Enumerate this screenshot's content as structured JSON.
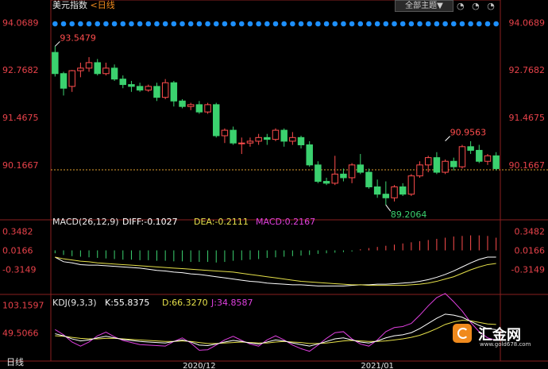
{
  "header": {
    "symbol_name": "美元指数",
    "period_tag": "<日线",
    "theme_button": "全部主题",
    "theme_arrow": "▼",
    "tool_icons": [
      "◔",
      "◔",
      "◔"
    ],
    "period_button": "日线"
  },
  "logo": {
    "name": "汇金网",
    "url": "www.gold678.com"
  },
  "colors": {
    "up": "#ff4d4d",
    "down": "#3bd16f",
    "axis_text": "#e8424a",
    "grid_text": "#f8e19a",
    "panel_text": "#e6e6e6",
    "yellow": "#e5e04a",
    "magenta": "#e040e0",
    "white": "#ffffff",
    "dots": "#1e90ff"
  },
  "chart_data": [
    {
      "panel": "price",
      "type": "candlestick",
      "y_ticks": [
        "94.0689",
        "92.7682",
        "91.4675",
        "90.1667"
      ],
      "y_tick_values": [
        94.0689,
        92.7682,
        91.4675,
        90.1667
      ],
      "ylim": [
        88.95,
        94.25
      ],
      "last_price_line": 90.1667,
      "annotations": [
        {
          "label": "93.5479",
          "value": 93.5479,
          "index": 0,
          "color": "#ff4d4d"
        },
        {
          "label": "90.9563",
          "value": 90.9563,
          "index": 46,
          "color": "#ff4d4d"
        },
        {
          "label": "89.2064",
          "value": 89.2064,
          "index": 39,
          "color": "#3bd16f"
        }
      ],
      "ohlc": [
        [
          93.38,
          93.55,
          92.72,
          92.8
        ],
        [
          92.8,
          92.85,
          92.2,
          92.4
        ],
        [
          92.45,
          92.9,
          92.3,
          92.88
        ],
        [
          92.88,
          93.1,
          92.7,
          92.95
        ],
        [
          92.95,
          93.25,
          92.85,
          93.1
        ],
        [
          93.1,
          93.2,
          92.75,
          92.8
        ],
        [
          92.8,
          93.1,
          92.75,
          92.95
        ],
        [
          92.95,
          93.05,
          92.6,
          92.65
        ],
        [
          92.65,
          92.75,
          92.4,
          92.5
        ],
        [
          92.5,
          92.6,
          92.3,
          92.45
        ],
        [
          92.45,
          92.55,
          92.3,
          92.35
        ],
        [
          92.35,
          92.5,
          92.3,
          92.45
        ],
        [
          92.45,
          92.55,
          92.05,
          92.15
        ],
        [
          92.15,
          92.65,
          92.1,
          92.55
        ],
        [
          92.55,
          92.6,
          91.9,
          92.05
        ],
        [
          92.05,
          92.1,
          91.85,
          91.9
        ],
        [
          91.9,
          92.0,
          91.8,
          91.95
        ],
        [
          91.95,
          92.05,
          91.7,
          91.75
        ],
        [
          91.75,
          92.0,
          91.7,
          91.95
        ],
        [
          91.95,
          92.0,
          91.05,
          91.1
        ],
        [
          91.1,
          91.3,
          90.9,
          91.25
        ],
        [
          91.25,
          91.35,
          90.85,
          90.9
        ],
        [
          90.9,
          91.05,
          90.6,
          90.9
        ],
        [
          90.9,
          91.05,
          90.8,
          90.95
        ],
        [
          90.95,
          91.15,
          90.85,
          91.05
        ],
        [
          91.05,
          91.15,
          90.85,
          91.0
        ],
        [
          91.0,
          91.3,
          90.95,
          91.25
        ],
        [
          91.25,
          91.3,
          90.8,
          90.95
        ],
        [
          90.95,
          91.2,
          90.85,
          91.05
        ],
        [
          91.05,
          91.1,
          90.75,
          90.85
        ],
        [
          90.85,
          90.95,
          90.25,
          90.3
        ],
        [
          90.3,
          90.4,
          89.8,
          89.85
        ],
        [
          89.85,
          89.95,
          89.75,
          89.8
        ],
        [
          89.8,
          90.55,
          89.75,
          90.05
        ],
        [
          90.05,
          90.2,
          89.85,
          89.95
        ],
        [
          89.95,
          90.35,
          89.8,
          90.3
        ],
        [
          90.3,
          90.6,
          90.05,
          90.1
        ],
        [
          90.1,
          90.2,
          89.65,
          89.7
        ],
        [
          89.7,
          89.9,
          89.4,
          89.5
        ],
        [
          89.5,
          89.85,
          89.2,
          89.4
        ]
      ],
      "ohlc_tail": [
        [
          89.4,
          89.75,
          89.3,
          89.7
        ],
        [
          89.7,
          89.8,
          89.45,
          89.5
        ],
        [
          89.5,
          90.05,
          89.45,
          90.0
        ],
        [
          90.0,
          90.4,
          89.95,
          90.3
        ],
        [
          90.3,
          90.55,
          90.1,
          90.5
        ],
        [
          90.5,
          90.65,
          90.05,
          90.1
        ],
        [
          90.1,
          90.45,
          90.05,
          90.4
        ],
        [
          90.4,
          90.5,
          90.15,
          90.25
        ],
        [
          90.25,
          90.85,
          90.2,
          90.8
        ],
        [
          90.8,
          90.95,
          90.6,
          90.7
        ],
        [
          90.7,
          90.85,
          90.35,
          90.4
        ],
        [
          90.4,
          90.6,
          90.3,
          90.55
        ],
        [
          90.55,
          90.65,
          90.15,
          90.2
        ]
      ]
    },
    {
      "panel": "macd",
      "title": "MACD(26,12,9)",
      "readouts": [
        {
          "label": "DIFF:-0.1027",
          "color": "#ffffff"
        },
        {
          "label": "DEA:-0.2111",
          "color": "#e5e04a"
        },
        {
          "label": "MACD:0.2167",
          "color": "#e040e0"
        }
      ],
      "y_ticks": [
        "0.3482",
        "0.0166",
        "-0.3149"
      ],
      "y_tick_values": [
        0.3482,
        0.0166,
        -0.3149
      ],
      "ylim": [
        -0.65,
        0.45
      ],
      "histogram": [
        -0.05,
        -0.08,
        -0.1,
        -0.11,
        -0.12,
        -0.13,
        -0.14,
        -0.15,
        -0.16,
        -0.16,
        -0.17,
        -0.17,
        -0.18,
        -0.18,
        -0.19,
        -0.19,
        -0.2,
        -0.2,
        -0.2,
        -0.21,
        -0.2,
        -0.18,
        -0.17,
        -0.16,
        -0.15,
        -0.13,
        -0.12,
        -0.11,
        -0.1,
        -0.09,
        -0.08,
        -0.06,
        -0.05,
        -0.04,
        -0.03,
        -0.02,
        0.02,
        0.04,
        0.06,
        0.08,
        0.1,
        0.12,
        0.14,
        0.16,
        0.18,
        0.2,
        0.22,
        0.24,
        0.25,
        0.26,
        0.26,
        0.25,
        0.22
      ],
      "diff": [
        -0.1,
        -0.18,
        -0.2,
        -0.23,
        -0.24,
        -0.24,
        -0.25,
        -0.26,
        -0.27,
        -0.28,
        -0.29,
        -0.31,
        -0.33,
        -0.34,
        -0.36,
        -0.37,
        -0.39,
        -0.4,
        -0.42,
        -0.44,
        -0.46,
        -0.48,
        -0.5,
        -0.52,
        -0.53,
        -0.55,
        -0.56,
        -0.57,
        -0.58,
        -0.58,
        -0.59,
        -0.6,
        -0.6,
        -0.6,
        -0.6,
        -0.59,
        -0.58,
        -0.58,
        -0.57,
        -0.57,
        -0.56,
        -0.55,
        -0.54,
        -0.52,
        -0.49,
        -0.45,
        -0.4,
        -0.34,
        -0.27,
        -0.2,
        -0.14,
        -0.1,
        -0.1
      ],
      "dea": [
        -0.1,
        -0.13,
        -0.15,
        -0.17,
        -0.18,
        -0.2,
        -0.21,
        -0.22,
        -0.23,
        -0.24,
        -0.25,
        -0.26,
        -0.27,
        -0.28,
        -0.29,
        -0.3,
        -0.31,
        -0.32,
        -0.33,
        -0.34,
        -0.35,
        -0.36,
        -0.38,
        -0.4,
        -0.42,
        -0.44,
        -0.46,
        -0.48,
        -0.5,
        -0.52,
        -0.53,
        -0.54,
        -0.55,
        -0.56,
        -0.57,
        -0.58,
        -0.58,
        -0.59,
        -0.59,
        -0.59,
        -0.59,
        -0.59,
        -0.58,
        -0.57,
        -0.55,
        -0.52,
        -0.48,
        -0.44,
        -0.38,
        -0.32,
        -0.27,
        -0.23,
        -0.21
      ]
    },
    {
      "panel": "kdj",
      "title": "KDJ(9,3,3)",
      "readouts": [
        {
          "label": "K:55.8375",
          "color": "#ffffff"
        },
        {
          "label": "D:66.3270",
          "color": "#e5e04a"
        },
        {
          "label": "J:34.8587",
          "color": "#e040e0"
        }
      ],
      "y_ticks": [
        "103.1597",
        "49.5066"
      ],
      "y_tick_values": [
        103.1597,
        49.5066
      ],
      "ylim": [
        -5,
        115
      ],
      "x_labels": [
        {
          "label": "2020/12",
          "index": 17
        },
        {
          "label": "2021/01",
          "index": 38
        }
      ],
      "k": [
        48,
        44,
        38,
        34,
        36,
        40,
        43,
        40,
        37,
        35,
        33,
        32,
        31,
        30,
        33,
        36,
        32,
        26,
        25,
        28,
        32,
        35,
        33,
        30,
        28,
        32,
        36,
        34,
        30,
        27,
        24,
        28,
        33,
        38,
        40,
        36,
        32,
        30,
        34,
        40,
        44,
        46,
        50,
        58,
        68,
        78,
        86,
        84,
        80,
        72,
        64,
        58,
        56
      ],
      "d": [
        44,
        43,
        41,
        39,
        38,
        38,
        39,
        39,
        38,
        37,
        36,
        35,
        34,
        33,
        33,
        34,
        33,
        31,
        29,
        29,
        30,
        31,
        32,
        31,
        30,
        30,
        32,
        33,
        32,
        31,
        29,
        29,
        30,
        32,
        34,
        35,
        34,
        33,
        33,
        34,
        36,
        38,
        41,
        45,
        51,
        58,
        66,
        71,
        74,
        73,
        70,
        67,
        66
      ],
      "j": [
        56,
        46,
        32,
        24,
        32,
        44,
        51,
        42,
        35,
        31,
        27,
        26,
        25,
        24,
        33,
        40,
        30,
        16,
        17,
        26,
        36,
        43,
        35,
        28,
        24,
        36,
        44,
        36,
        26,
        19,
        14,
        26,
        39,
        50,
        52,
        38,
        28,
        24,
        36,
        52,
        60,
        62,
        68,
        84,
        102,
        118,
        126,
        110,
        92,
        70,
        52,
        40,
        35
      ]
    }
  ]
}
